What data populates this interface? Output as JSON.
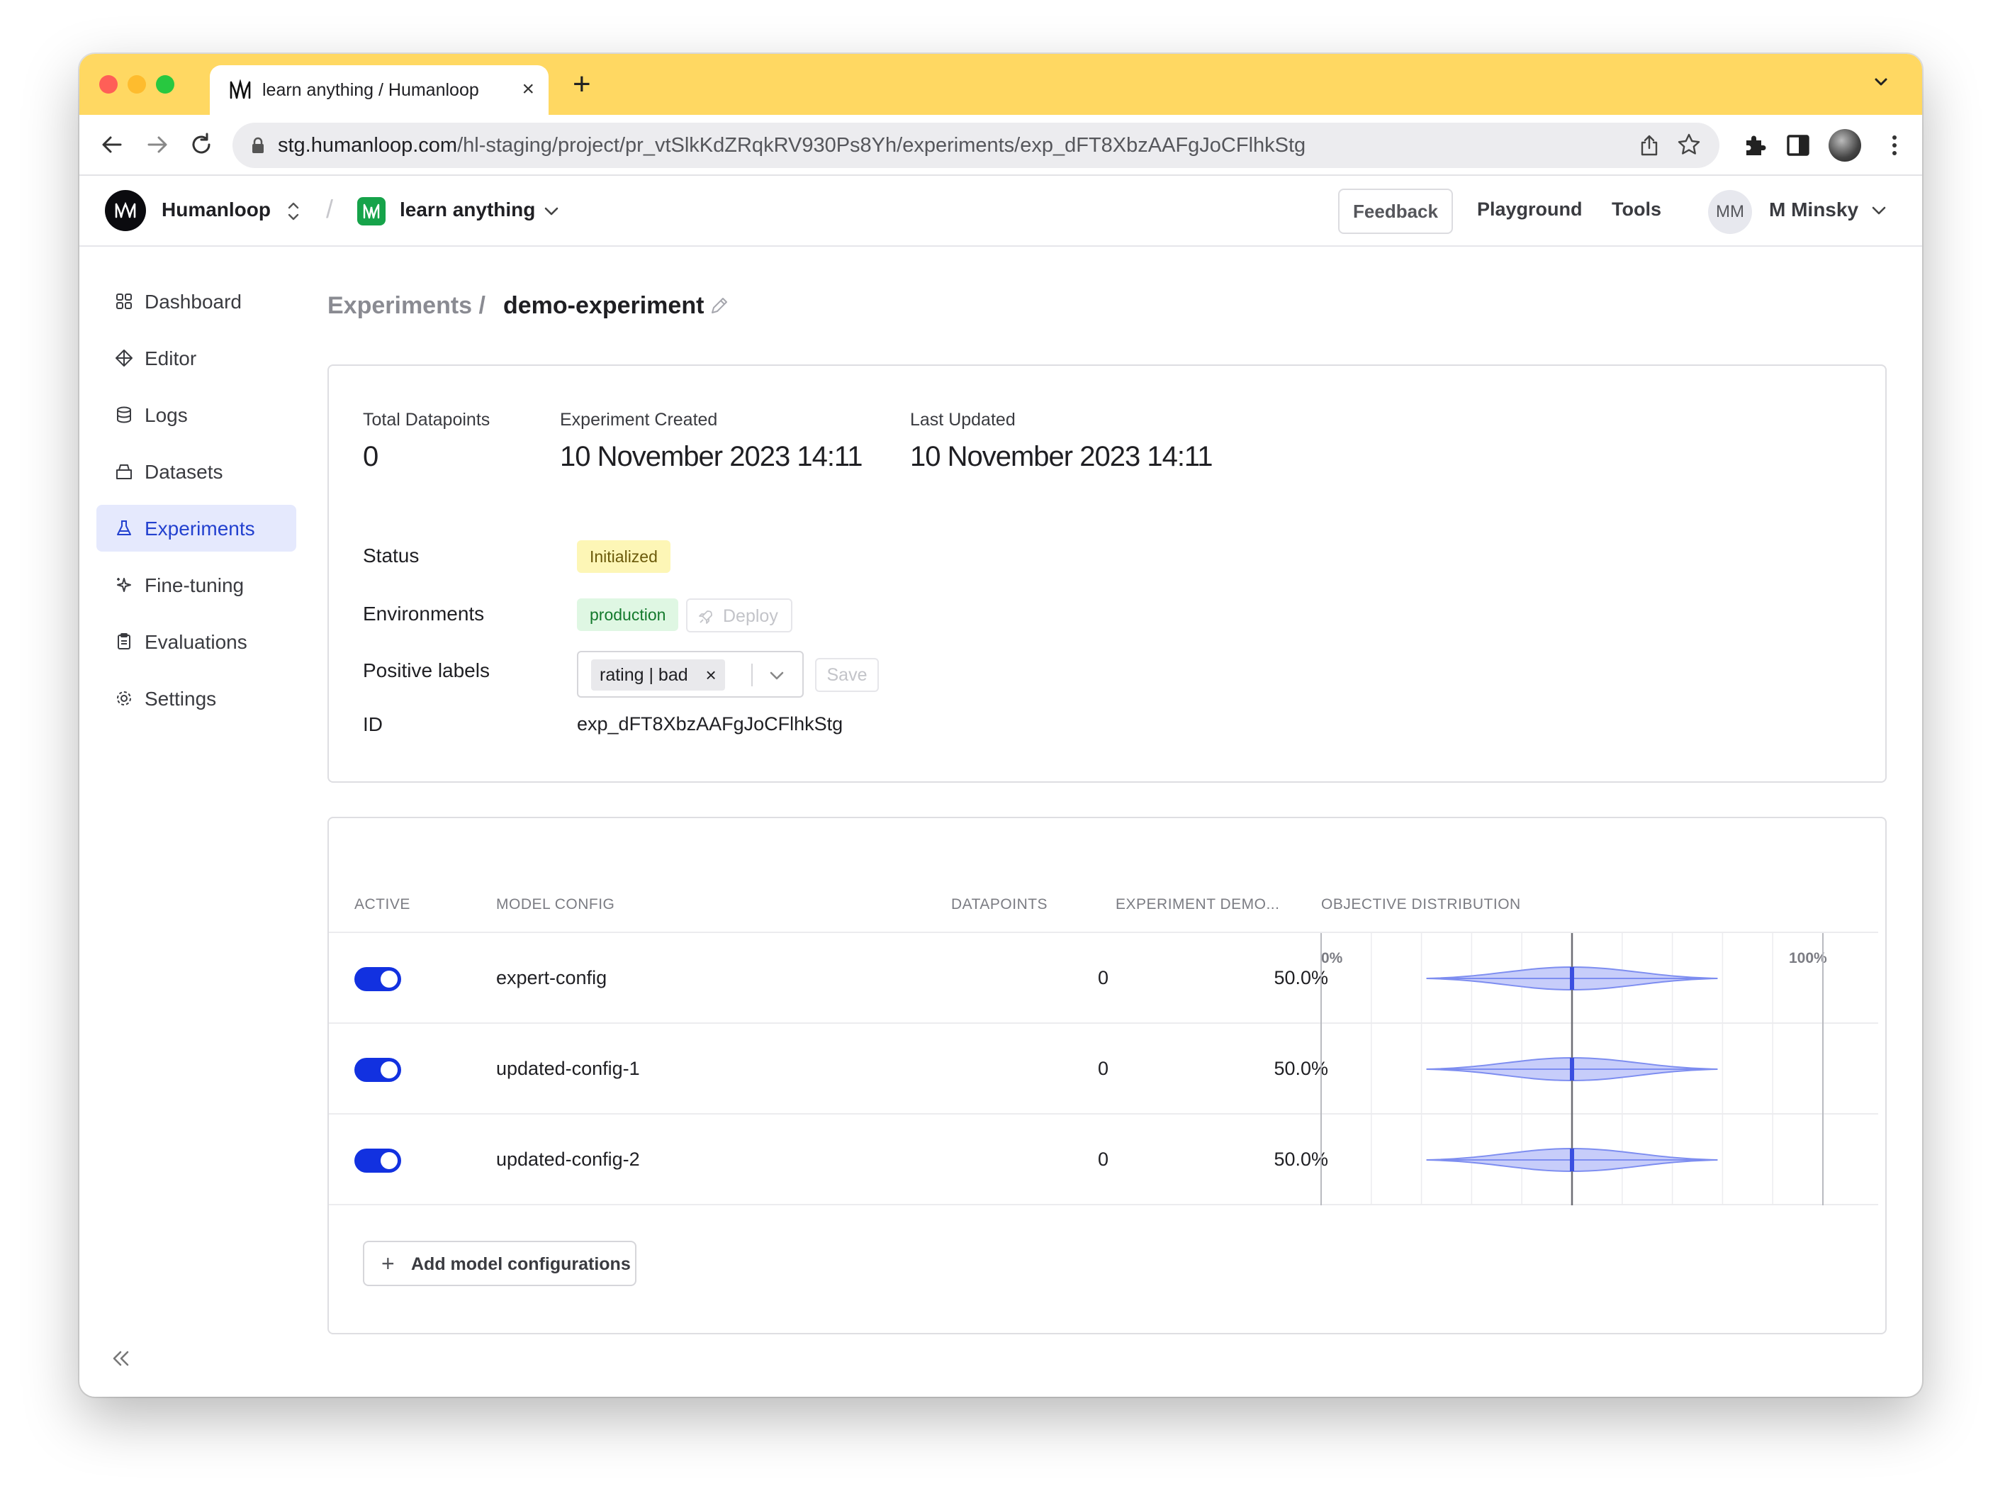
{
  "browser": {
    "tab_title": "learn anything / Humanloop",
    "new_tab_glyph": "+",
    "close_glyph": "×",
    "url_host": "stg.humanloop.com",
    "url_path": "/hl-staging/project/pr_vtSlkKdZRqkRV930Ps8Yh/experiments/exp_dFT8XbzAAFgJoCFlhkStg",
    "traffic_lights": {
      "close": "#ff5f57",
      "minimize": "#febc2e",
      "zoom": "#28c840"
    },
    "tab_strip_color": "#ffd862"
  },
  "header": {
    "org_name": "Humanloop",
    "separator": "/",
    "project_name": "learn anything",
    "feedback_label": "Feedback",
    "playground_label": "Playground",
    "tools_label": "Tools",
    "user_initials": "MM",
    "user_name": "M Minsky"
  },
  "sidebar": {
    "items": [
      {
        "label": "Dashboard",
        "icon": "grid-icon"
      },
      {
        "label": "Editor",
        "icon": "diamond-icon"
      },
      {
        "label": "Logs",
        "icon": "database-icon"
      },
      {
        "label": "Datasets",
        "icon": "box-icon"
      },
      {
        "label": "Experiments",
        "icon": "flask-icon",
        "active": true
      },
      {
        "label": "Fine-tuning",
        "icon": "sparkles-icon"
      },
      {
        "label": "Evaluations",
        "icon": "clipboard-icon"
      },
      {
        "label": "Settings",
        "icon": "gear-icon"
      }
    ],
    "active_color": "#2341cf"
  },
  "breadcrumb": {
    "parent": "Experiments /",
    "current": "demo-experiment"
  },
  "summary": {
    "stats": [
      {
        "label": "Total Datapoints",
        "value": "0"
      },
      {
        "label": "Experiment Created",
        "value": "10 November 2023 14:11"
      },
      {
        "label": "Last Updated",
        "value": "10 November 2023 14:11"
      }
    ],
    "status_label": "Status",
    "status_value": "Initialized",
    "environments_label": "Environments",
    "environment_value": "production",
    "deploy_label": "Deploy",
    "positive_labels_label": "Positive labels",
    "positive_label_chip": "rating | bad",
    "chip_remove_glyph": "×",
    "save_label": "Save",
    "id_label": "ID",
    "id_value": "exp_dFT8XbzAAFgJoCFlhkStg"
  },
  "table": {
    "columns": [
      "ACTIVE",
      "MODEL CONFIG",
      "DATAPOINTS",
      "EXPERIMENT DEMO...",
      "OBJECTIVE DISTRIBUTION"
    ],
    "axis_min_label": "0%",
    "axis_max_label": "100%",
    "rows": [
      {
        "active": true,
        "config": "expert-config",
        "datapoints": "0",
        "share": "50.0%",
        "median": 0.5
      },
      {
        "active": true,
        "config": "updated-config-1",
        "datapoints": "0",
        "share": "50.0%",
        "median": 0.5
      },
      {
        "active": true,
        "config": "updated-config-2",
        "datapoints": "0",
        "share": "50.0%",
        "median": 0.5
      }
    ],
    "add_label": "Add model configurations",
    "add_glyph": "+",
    "toggle_color": "#1231e0",
    "violin_fill": "#c7cdfa",
    "violin_stroke": "#7d8df0"
  }
}
